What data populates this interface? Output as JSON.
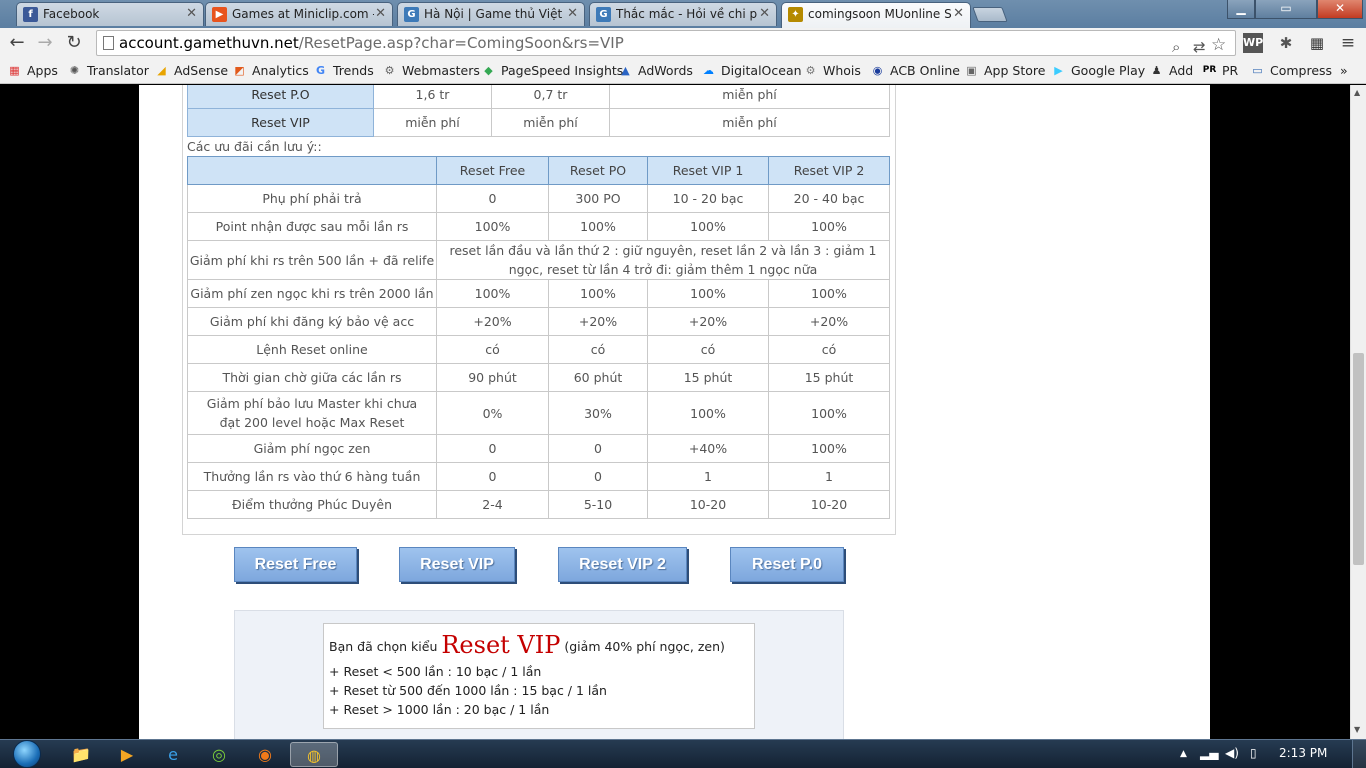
{
  "tabs": [
    {
      "title": "Facebook",
      "color": "#3b5998",
      "glyph": "f"
    },
    {
      "title": "Games at Miniclip.com - P",
      "color": "#e8541e",
      "glyph": "▶"
    },
    {
      "title": "Hà Nội | Game thủ Việt N",
      "color": "#3d7ab8",
      "glyph": "G"
    },
    {
      "title": "Thắc mắc - Hỏi về chi phí",
      "color": "#3d7ab8",
      "glyph": "G"
    },
    {
      "title": "comingsoon MUonline SS",
      "color": "#b58a00",
      "glyph": "✦"
    }
  ],
  "url": {
    "host": "account.gamethuvn.net",
    "rest": "/ResetPage.asp?char=ComingSoon&rs=VIP"
  },
  "bookmarks": [
    "Apps",
    "Translator",
    "AdSense",
    "Analytics",
    "Trends",
    "Webmasters",
    "PageSpeed Insights",
    "AdWords",
    "DigitalOcean",
    "Whois",
    "ACB Online",
    "App Store",
    "Google Play",
    "Add",
    "PR",
    "Compress"
  ],
  "cost_table": {
    "rows": [
      {
        "label": "Reset P.O",
        "c1": "1,6 tr",
        "c2": "0,7 tr",
        "c3": "miễn phí"
      },
      {
        "label": "Reset VIP",
        "c1": "miễn phí",
        "c2": "miễn phí",
        "c3": "miễn phí"
      }
    ]
  },
  "note": "Các ưu đãi cần lưu ý::",
  "benefits": {
    "headers": [
      "",
      "Reset Free",
      "Reset PO",
      "Reset VIP 1",
      "Reset VIP 2"
    ],
    "rows": [
      [
        "Phụ phí phải trả",
        "0",
        "300 PO",
        "10 - 20 bạc",
        "20 - 40 bạc"
      ],
      [
        "Point nhận được sau mỗi lần rs",
        "100%",
        "100%",
        "100%",
        "100%"
      ],
      [
        "Giảm phí khi rs trên 500 lần + đã relife",
        "reset lần đầu và lần thứ 2 : giữ nguyên, reset lần 2 và lần 3 : giảm 1 ngọc, reset từ lần 4 trở đi: giảm thêm 1 ngọc nữa"
      ],
      [
        "Giảm phí zen ngọc khi rs trên 2000 lần",
        "100%",
        "100%",
        "100%",
        "100%"
      ],
      [
        "Giảm phí khi đăng ký bảo vệ acc",
        "+20%",
        "+20%",
        "+20%",
        "+20%"
      ],
      [
        "Lệnh Reset online",
        "có",
        "có",
        "có",
        "có"
      ],
      [
        "Thời gian chờ giữa các lần rs",
        "90 phút",
        "60 phút",
        "15 phút",
        "15 phút"
      ],
      [
        "Giảm phí bảo lưu Master khi chưa đạt 200 level hoặc Max Reset",
        "0%",
        "30%",
        "100%",
        "100%"
      ],
      [
        "Giảm phí ngọc zen",
        "0",
        "0",
        "+40%",
        "100%"
      ],
      [
        "Thưởng lần rs vào thứ 6 hàng tuần",
        "0",
        "0",
        "1",
        "1"
      ],
      [
        "Điểm thưởng Phúc Duyên",
        "2-4",
        "5-10",
        "10-20",
        "10-20"
      ]
    ]
  },
  "buttons": {
    "reset_free": "Reset Free",
    "reset_vip": "Reset VIP",
    "reset_vip2": "Reset VIP 2",
    "reset_po": "Reset P.0"
  },
  "info": {
    "prefix": "Bạn đã chọn kiểu",
    "choice": "Reset VIP",
    "suffix": "(giảm 40% phí ngọc, zen)",
    "lines": [
      "+ Reset < 500 lần : 10 bạc / 1 lần",
      "+ Reset từ 500 đến 1000 lần : 15 bạc / 1 lần",
      "+ Reset > 1000 lần : 20 bạc / 1 lần"
    ]
  },
  "clock": "2:13 PM"
}
